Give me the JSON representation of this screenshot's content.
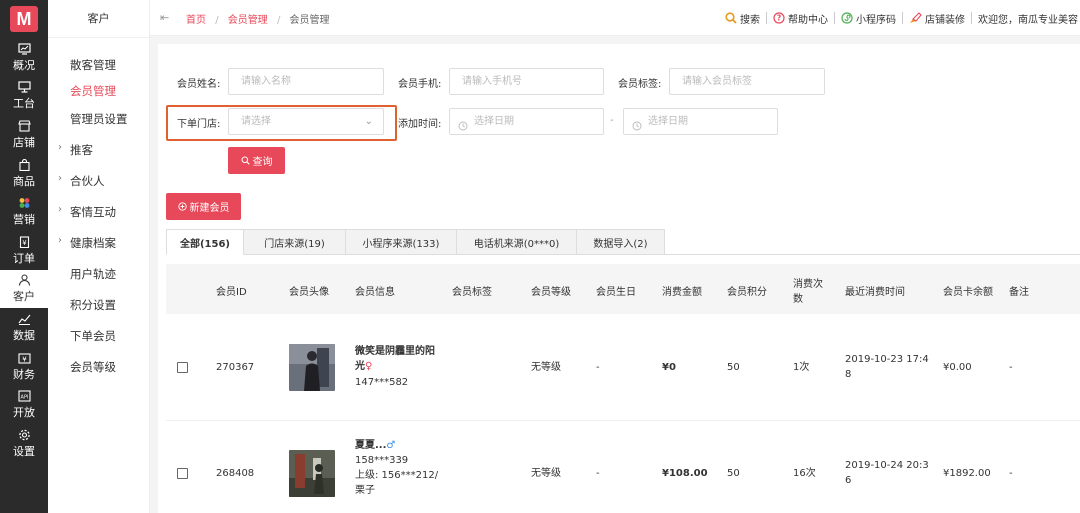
{
  "rail": {
    "logo": "M",
    "items": [
      {
        "label": "概况",
        "icon": "monitor-icon"
      },
      {
        "label": "工台",
        "icon": "desktop-icon"
      },
      {
        "label": "店铺",
        "icon": "store-icon"
      },
      {
        "label": "商品",
        "icon": "shopping-bag-icon"
      },
      {
        "label": "营销",
        "icon": "flower-icon"
      },
      {
        "label": "订单",
        "icon": "order-icon"
      },
      {
        "label": "客户",
        "icon": "user-icon"
      },
      {
        "label": "数据",
        "icon": "chart-icon"
      },
      {
        "label": "财务",
        "icon": "wallet-icon"
      },
      {
        "label": "开放",
        "icon": "api-icon"
      },
      {
        "label": "设置",
        "icon": "gear-icon"
      }
    ]
  },
  "sidebar": {
    "title": "客户",
    "items": [
      {
        "label": "散客管理",
        "expandable": false
      },
      {
        "label": "会员管理",
        "expandable": false,
        "active": true
      },
      {
        "label": "管理员设置",
        "expandable": false
      },
      {
        "label": "推客",
        "expandable": true
      },
      {
        "label": "合伙人",
        "expandable": true
      },
      {
        "label": "客情互动",
        "expandable": true
      },
      {
        "label": "健康档案",
        "expandable": true
      },
      {
        "label": "用户轨迹",
        "expandable": false
      },
      {
        "label": "积分设置",
        "expandable": false
      },
      {
        "label": "下单会员",
        "expandable": false
      },
      {
        "label": "会员等级",
        "expandable": false
      }
    ]
  },
  "topbar": {
    "breadcrumb": {
      "home": "首页",
      "section": "会员管理",
      "current": "会员管理",
      "sep": "/"
    },
    "tools": {
      "search": "搜索",
      "help": "帮助中心",
      "miniprogram": "小程序码",
      "decorate": "店铺装修",
      "welcome": "欢迎您，南瓜专业美容"
    }
  },
  "filters": {
    "name_label": "会员姓名:",
    "name_placeholder": "请输入名称",
    "phone_label": "会员手机:",
    "phone_placeholder": "请输入手机号",
    "tag_label": "会员标签:",
    "tag_placeholder": "请输入会员标签",
    "store_label": "下单门店:",
    "store_placeholder": "请选择",
    "date_label": "添加时间:",
    "date_start_placeholder": "选择日期",
    "date_sep": "-",
    "date_end_placeholder": "选择日期",
    "query_button": "查询"
  },
  "actions": {
    "new_member": "新建会员"
  },
  "tabs": [
    {
      "label": "全部(156)",
      "active": true
    },
    {
      "label": "门店来源(19)"
    },
    {
      "label": "小程序来源(133)"
    },
    {
      "label": "电话机来源(0***0)"
    },
    {
      "label": "数据导入(2)"
    }
  ],
  "table": {
    "columns": {
      "id": "会员ID",
      "avatar": "会员头像",
      "info": "会员信息",
      "tag": "会员标签",
      "level": "会员等级",
      "birthday": "会员生日",
      "spend": "消费金额",
      "points": "会员积分",
      "count_l1": "消费次",
      "count_l2": "数",
      "last_time": "最近消费时间",
      "balance": "会员卡余额",
      "note": "备注"
    },
    "rows": [
      {
        "id": "270367",
        "name_l1": "微笑是阴霾里的阳",
        "name_l2": "光",
        "gender_icon": "female-icon",
        "phone": "147***582",
        "level": "无等级",
        "birthday": "-",
        "spend": "¥0",
        "points": "50",
        "count": "1次",
        "time_l1": "2019-10-23 17:4",
        "time_l2": "8",
        "balance": "¥0.00",
        "note": "-"
      },
      {
        "id": "268408",
        "name": "夏夏...",
        "gender_icon": "male-icon",
        "phone": "158***339",
        "superior_l1": "上级: 156***212/",
        "superior_l2": "栗子",
        "level": "无等级",
        "birthday": "-",
        "spend": "¥108.00",
        "points": "50",
        "count": "16次",
        "time_l1": "2019-10-24 20:3",
        "time_l2": "6",
        "balance": "¥1892.00",
        "note": "-"
      }
    ]
  },
  "colors": {
    "accent": "#e8495a",
    "highlight": "#e06030",
    "rail_bg": "#2b2b2b"
  }
}
